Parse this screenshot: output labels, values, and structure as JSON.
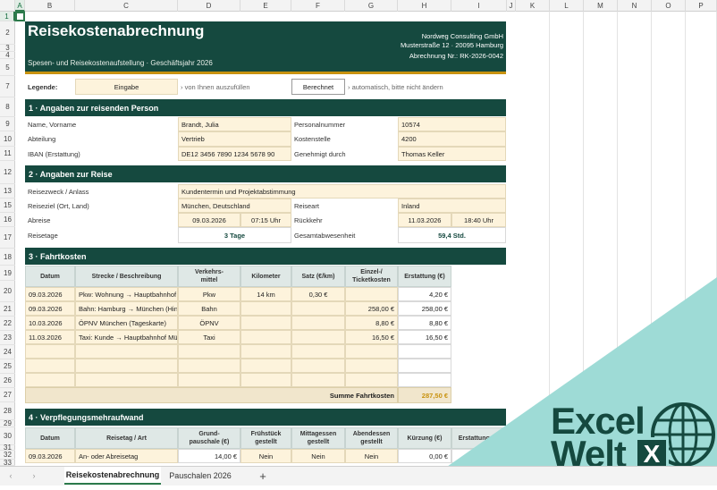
{
  "columns": [
    "A",
    "B",
    "C",
    "D",
    "E",
    "F",
    "G",
    "H",
    "I",
    "J",
    "K",
    "L",
    "M",
    "N",
    "O",
    "P"
  ],
  "selected_column": "A",
  "rows": [
    "1",
    "2",
    "3",
    "4",
    "5",
    "7",
    "8",
    "9",
    "10",
    "11",
    "12",
    "13",
    "15",
    "16",
    "17",
    "18",
    "19",
    "20",
    "21",
    "22",
    "23",
    "24",
    "25",
    "26",
    "27",
    "28",
    "29",
    "30",
    "31",
    "32",
    "33"
  ],
  "selected_row": "1",
  "header": {
    "title": "Reisekostenabrechnung",
    "subtitle": "Spesen- und Reisekostenaufstellung · Geschäftsjahr 2026",
    "company": "Nordweg Consulting GmbH",
    "address": "Musterstraße 12 · 20095 Hamburg",
    "doc_no": "Abrechnung Nr.: RK-2026-0042"
  },
  "legend": {
    "label": "Legende:",
    "input_label": "Eingabe",
    "input_desc": "› von Ihnen auszufüllen",
    "calc_label": "Berechnet",
    "calc_desc": "› automatisch, bitte nicht ändern"
  },
  "section1": {
    "title": "1  ·  Angaben zur reisenden Person",
    "name_label": "Name, Vorname",
    "name": "Brandt, Julia",
    "pnr_label": "Personalnummer",
    "pnr": "10574",
    "dept_label": "Abteilung",
    "dept": "Vertrieb",
    "cc_label": "Kostenstelle",
    "cc": "4200",
    "iban_label": "IBAN (Erstattung)",
    "iban": "DE12 3456 7890 1234 5678 90",
    "approved_label": "Genehmigt durch",
    "approved": "Thomas Keller"
  },
  "section2": {
    "title": "2  ·  Angaben zur Reise",
    "purpose_label": "Reisezweck / Anlass",
    "purpose": "Kundentermin und Projektabstimmung",
    "dest_label": "Reiseziel (Ort, Land)",
    "dest": "München, Deutschland",
    "type_label": "Reiseart",
    "type": "Inland",
    "dep_label": "Abreise",
    "dep_date": "09.03.2026",
    "dep_time": "07:15 Uhr",
    "ret_label": "Rückkehr",
    "ret_date": "11.03.2026",
    "ret_time": "18:40 Uhr",
    "days_label": "Reisetage",
    "days": "3 Tage",
    "absence_label": "Gesamtabwesenheit",
    "absence": "59,4 Std."
  },
  "section3": {
    "title": "3  ·  Fahrtkosten",
    "headers": [
      "Datum",
      "Strecke / Beschreibung",
      "Verkehrs-\nmittel",
      "Kilometer",
      "Satz (€/km)",
      "Einzel-/\nTicketkosten",
      "Erstattung (€)"
    ],
    "rows": [
      [
        "09.03.2026",
        "Pkw: Wohnung → Hauptbahnhof Hamburg",
        "Pkw",
        "14 km",
        "0,30 €",
        "",
        "4,20 €"
      ],
      [
        "09.03.2026",
        "Bahn: Hamburg → München (Hin + Rück)",
        "Bahn",
        "",
        "",
        "258,00 €",
        "258,00 €"
      ],
      [
        "10.03.2026",
        "ÖPNV München (Tageskarte)",
        "ÖPNV",
        "",
        "",
        "8,80 €",
        "8,80 €"
      ],
      [
        "11.03.2026",
        "Taxi: Kunde → Hauptbahnhof München",
        "Taxi",
        "",
        "",
        "16,50 €",
        "16,50 €"
      ]
    ],
    "sum_label": "Summe Fahrtkosten",
    "sum": "287,50 €"
  },
  "section4": {
    "title": "4  ·  Verpflegungsmehraufwand",
    "headers": [
      "Datum",
      "Reisetag / Art",
      "Grund-\npauschale (€)",
      "Frühstück\ngestellt",
      "Mittagessen\ngestellt",
      "Abendessen\ngestellt",
      "Kürzung (€)",
      "Erstattung (€)"
    ],
    "row": [
      "09.03.2026",
      "An- oder Abreisetag",
      "14,00 €",
      "Nein",
      "Nein",
      "Nein",
      "0,00 €",
      ""
    ]
  },
  "tabs": [
    "Reisekostenabrechnung",
    "Pauschalen 2026"
  ],
  "add_tab": "+",
  "logo": {
    "word1": "Excel",
    "word2": "Welt",
    "badge": "X"
  },
  "colors": {
    "primary": "#15493f",
    "input": "#fdf3dc",
    "accent": "#c8920f",
    "teal": "#9edbd6"
  }
}
